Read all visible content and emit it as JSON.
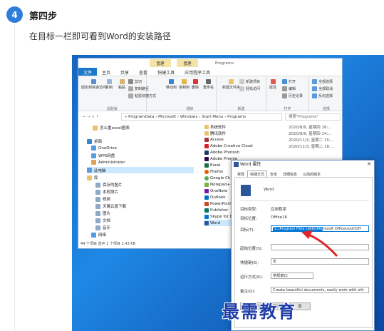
{
  "step": {
    "number": "4",
    "title": "第四步",
    "description": "在目标一栏即可看到Word的安装路径"
  },
  "explorer": {
    "context_tabs": [
      "管理",
      "管理",
      "Programs"
    ],
    "ribbon_tabs": [
      "文件",
      "主页",
      "共享",
      "查看",
      "快捷工具",
      "应用程序工具"
    ],
    "ribbon_groups": {
      "clipboard": {
        "label": "剪贴板",
        "pin": "固定到快速访问",
        "copy": "复制",
        "paste": "粘贴",
        "cut": "剪切",
        "copy_path": "复制路径",
        "paste_shortcut": "粘贴快捷方式"
      },
      "organize": {
        "label": "组织",
        "move": "移动到",
        "copy": "复制到",
        "delete": "删除",
        "rename": "重命名"
      },
      "new": {
        "label": "新建",
        "new_folder": "新建文件夹",
        "new_item": "新建项目",
        "easy_access": "轻松访问"
      },
      "open": {
        "label": "打开",
        "properties": "属性",
        "open": "打开",
        "edit": "编辑",
        "history": "历史记录"
      },
      "select": {
        "label": "选择",
        "all": "全部选择",
        "none": "全部取消",
        "invert": "反向选择"
      }
    },
    "address": "« ProgramData › Microsoft › Windows › Start Menu › Programs",
    "search_placeholder": "搜索\"Programs\"",
    "nav": [
      "怎么重excel图表",
      "桌面",
      "OneDrive",
      "WPS网盘",
      "Administrator",
      "此电脑",
      "库",
      "保存的图片",
      "本机照片",
      "视频",
      "天翼云盘下载",
      "图片",
      "文档",
      "音乐",
      "网络"
    ],
    "files": [
      {
        "name": "系统软件",
        "date": "2020/8/6, 星期四 16:..."
      },
      {
        "name": "腾讯软件",
        "date": "2020/8/6, 星期四 14:..."
      },
      {
        "name": "Access",
        "date": "2020/11/3, 星期二 15:..."
      },
      {
        "name": "Adobe Creative Cloud",
        "date": "2020/11/3, 星期二 18:..."
      },
      {
        "name": "Adobe Photosh",
        "date": ""
      },
      {
        "name": "Adobe Premie",
        "date": ""
      },
      {
        "name": "Excel",
        "date": ""
      },
      {
        "name": "Firefox",
        "date": ""
      },
      {
        "name": "Google Chron",
        "date": ""
      },
      {
        "name": "Notepad++",
        "date": ""
      },
      {
        "name": "OneNote",
        "date": ""
      },
      {
        "name": "Outlook",
        "date": ""
      },
      {
        "name": "PowerPoint",
        "date": ""
      },
      {
        "name": "Publisher",
        "date": ""
      },
      {
        "name": "Skype for Bus",
        "date": ""
      },
      {
        "name": "Word",
        "date": ""
      }
    ],
    "status": "44 个项目    选中 1 个项目  2.43 KB"
  },
  "dialog": {
    "title": "Word 属性",
    "tabs": [
      "常规",
      "快捷方式",
      "安全",
      "详细信息",
      "以前的版本"
    ],
    "app_name": "Word",
    "target_type_label": "目标类型:",
    "target_type": "应用程序",
    "target_location_label": "目标位置:",
    "target_location": "Office16",
    "target_label": "目标(T):",
    "target_selected": "\"C:\\Program Files (x86)\\Mic",
    "target_rest": "rosoft Office\\root\\Off",
    "start_in_label": "起始位置(S):",
    "shortcut_key_label": "快捷键(K):",
    "shortcut_key": "无",
    "run_label": "运行方式(R):",
    "run_value": "常规窗口",
    "comment_label": "备注(O):",
    "comment": "Create beautiful documents, easily work with oth",
    "open_location_btn": "打开文件所在的位置(F)",
    "change_icon_btn": "更"
  },
  "watermark": "最需教育",
  "colors": {
    "accent": "#2f7ddb",
    "file_tab": "#1979ca",
    "selection": "#0078d7",
    "arrow": "#e0262b"
  }
}
